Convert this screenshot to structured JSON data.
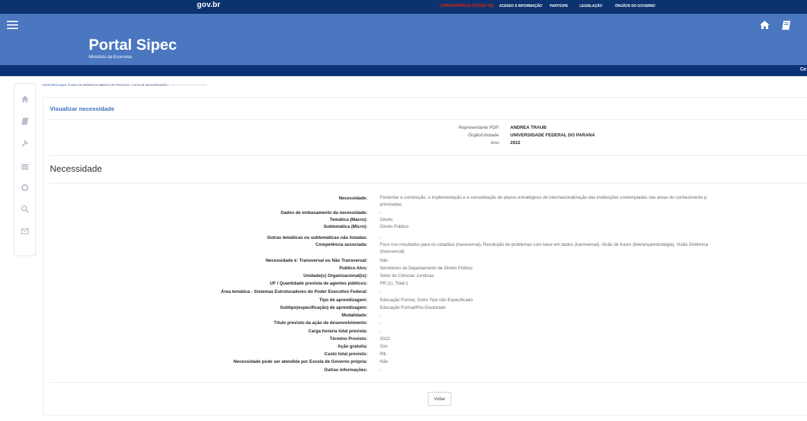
{
  "govbar": {
    "logo": "gov.br",
    "covid": "CORONAVÍRUS (COVID-19)",
    "links": [
      "ACESSO À INFORMAÇÃO",
      "PARTICIPE",
      "LEGISLAÇÃO",
      "ÓRGÃOS DO GOVERNO"
    ]
  },
  "header": {
    "title": "Portal Sipec",
    "subtitle": "Ministério da Economia",
    "subbar_text": "Ce"
  },
  "breadcrumb": {
    "prefix": "VOCÊ ESTÁ AQUI:",
    "items": [
      "PLANO DE DESENVOLVIMENTO DE PESSOAS",
      "LISTA DE NECESSIDADES",
      "VISUALIZAR NECESSIDADE"
    ],
    "separator": "»"
  },
  "page": {
    "title": "Visualizar necessidade",
    "info": [
      {
        "label": "Representante PDP:",
        "value": "ANDREA TRAUB"
      },
      {
        "label": "Órgão/Unidade:",
        "value": "UNIVERSIDADE FEDERAL DO PARANA"
      },
      {
        "label": "Ano:",
        "value": "2022"
      }
    ],
    "section_title": "Necessidade",
    "rows": [
      {
        "label": "Necessidade:",
        "value": "Fomentar a construção, a implementação e a consolidação de planos estratégicos de internacionalização das instituições contempladas nas áreas do conhecimento p",
        "value2": "priorizadas."
      },
      {
        "label": "Dados de embasamento da necessidade:",
        "value": "-"
      },
      {
        "label": "Temática (Macro):",
        "value": "Direito"
      },
      {
        "label": "Subtemática (Micro):",
        "value": "Direito Público"
      },
      {
        "label": "Outras temáticas ou subtemáticas não listadas:",
        "value": "-"
      },
      {
        "label": "Competência associada:",
        "value": "Foco nos resultados para os cidadãos (transversal), Resolução de problemas com base em dados (transversal), Visão de futuro (liderança/estratégia), Visão Sistêmica",
        "value2": "(transversal)"
      },
      {
        "label": "Necessidade é: Transversal ou Não Transversal:",
        "value": "Não"
      },
      {
        "label": "Publico Alvo:",
        "value": "Servidores do Departamento de Direito Público"
      },
      {
        "label": "Unidade(s) Organizacional(is):",
        "value": "Setor de Ciências Jurídicas"
      },
      {
        "label": "UF / Quantidade prevista de agentes públicos:",
        "value": "PR (1). Total:1"
      },
      {
        "label": "Área temática - Sistemas Estruturadores do Poder Executivo Federal:",
        "value": "-"
      },
      {
        "label": "Tipo de aprendizagem:",
        "value": "Educação Formal, Outro Tipo não Especificado"
      },
      {
        "label": "Subtipo(especificação) de aprendizagem:",
        "value": "Educação Formal/Pós-Doutorado"
      },
      {
        "label": "Modalidade:",
        "value": "-"
      },
      {
        "label": "Título previsto da ação de desenvolvimento:",
        "value": "-"
      },
      {
        "label": "Carga horária total prevista:",
        "value": "-"
      },
      {
        "label": "Término Previsto:",
        "value": "2022"
      },
      {
        "label": "Ação gratuita:",
        "value": "Sim"
      },
      {
        "label": "Custo total previsto:",
        "value": "R$ -"
      },
      {
        "label": "Necessidade pode ser atendida por Escola de Governo própria:",
        "value": "Não"
      },
      {
        "label": "Outras informações:",
        "value": "-"
      }
    ],
    "back_button": "Voltar"
  },
  "icons": {
    "menu": "menu-icon",
    "home": "home-icon",
    "book": "book-icon",
    "sidebar": [
      "home-icon",
      "book-icon",
      "tools-icon",
      "list-icon",
      "gear-icon",
      "search-icon",
      "mail-icon"
    ]
  },
  "colors": {
    "govbar": "#0c326f",
    "header": "#4a77c0",
    "subbar": "#0b3275",
    "link": "#3a6db5",
    "covid": "#e52207"
  }
}
